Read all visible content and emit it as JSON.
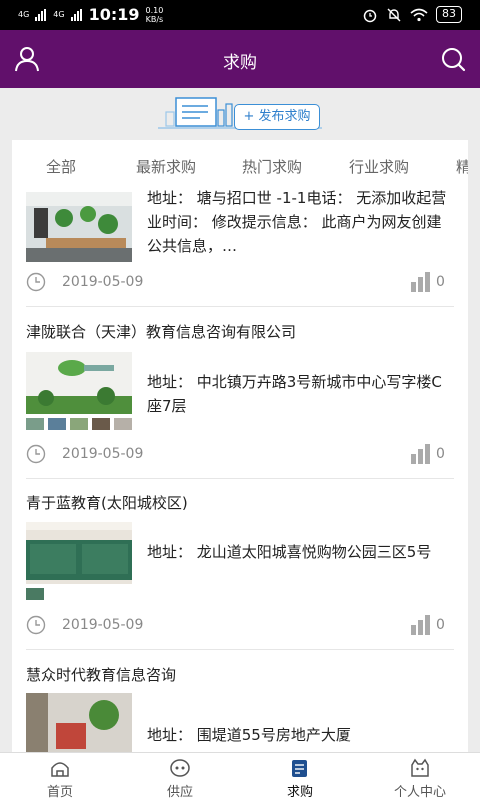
{
  "status": {
    "signal1": "4G",
    "signal2": "4G",
    "time": "10:19",
    "speed_value": "0.10",
    "speed_unit": "KB/s",
    "battery": "83"
  },
  "header": {
    "title": "求购"
  },
  "banner": {
    "publish_label": "+ 发布求购"
  },
  "tabs": [
    "全部",
    "最新求购",
    "热门求购",
    "行业求购",
    "精"
  ],
  "items": [
    {
      "title": "",
      "address": "地址： 塘与招口世 -1-1电话： 无添加收起营业时间： 修改提示信息： 此商户为网友创建公共信息，…",
      "date": "2019-05-09",
      "count": "0"
    },
    {
      "title": "津陇联合（天津）教育信息咨询有限公司",
      "address": "地址： 中北镇万卉路3号新城市中心写字楼C座7层",
      "date": "2019-05-09",
      "count": "0"
    },
    {
      "title": "青于蓝教育(太阳城校区)",
      "address": "地址： 龙山道太阳城喜悦购物公园三区5号",
      "date": "2019-05-09",
      "count": "0"
    },
    {
      "title": "慧众时代教育信息咨询",
      "address": "地址： 围堤道55号房地产大厦",
      "date": "",
      "count": ""
    }
  ],
  "bottom_nav": [
    {
      "label": "首页",
      "icon": "home-icon"
    },
    {
      "label": "供应",
      "icon": "supply-icon"
    },
    {
      "label": "求购",
      "icon": "purchase-icon"
    },
    {
      "label": "个人中心",
      "icon": "profile-icon"
    }
  ],
  "colors": {
    "header": "#61106b",
    "accent": "#2f7fcc",
    "active_tab": "#111111"
  }
}
